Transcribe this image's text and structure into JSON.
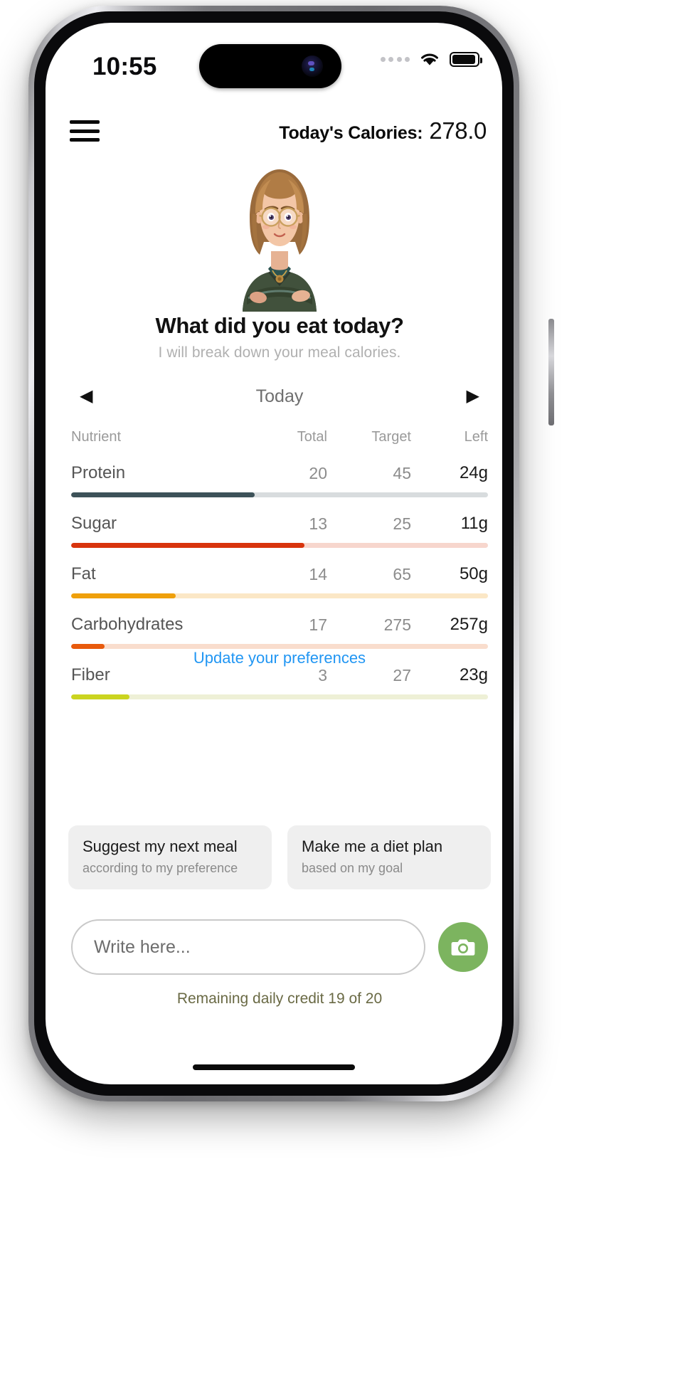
{
  "status_bar": {
    "time": "10:55",
    "signal_icon": "signal-dots-icon",
    "wifi_icon": "wifi-icon",
    "battery_icon": "battery-icon"
  },
  "header": {
    "menu_icon": "hamburger-menu-icon",
    "calories_label": "Today's Calories:",
    "calories_value": "278.0"
  },
  "hero": {
    "avatar_name": "nutritionist-avatar",
    "title": "What did you eat today?",
    "subtitle": "I will break down your meal calories."
  },
  "date_nav": {
    "prev_icon": "◀",
    "label": "Today",
    "next_icon": "▶"
  },
  "table": {
    "columns": [
      "Nutrient",
      "Total",
      "Target",
      "Left"
    ],
    "rows": [
      {
        "name": "Protein",
        "total": "20",
        "target": "45",
        "left": "24g",
        "percent": 44,
        "fill_color": "#3d5259",
        "track_color": "#d8dcde"
      },
      {
        "name": "Sugar",
        "total": "13",
        "target": "25",
        "left": "11g",
        "percent": 56,
        "fill_color": "#d8340d",
        "track_color": "#f7d6cd"
      },
      {
        "name": "Fat",
        "total": "14",
        "target": "65",
        "left": "50g",
        "percent": 25,
        "fill_color": "#efa00b",
        "track_color": "#fbe7c6"
      },
      {
        "name": "Carbohydrates",
        "total": "17",
        "target": "275",
        "left": "257g",
        "percent": 8,
        "fill_color": "#e85a0c",
        "track_color": "#f9ddcd"
      },
      {
        "name": "Fiber",
        "total": "3",
        "target": "27",
        "left": "23g",
        "percent": 14,
        "fill_color": "#cbd41f",
        "track_color": "#eef0d6"
      }
    ]
  },
  "preferences_link": "Update your preferences",
  "suggestions": [
    {
      "title": "Suggest my next meal",
      "subtitle": "according to my preference"
    },
    {
      "title": "Make me a diet plan",
      "subtitle": "based on my goal"
    }
  ],
  "composer": {
    "placeholder": "Write here...",
    "camera_icon": "camera-icon",
    "camera_color": "#7cb45f"
  },
  "credit_text": "Remaining daily credit 19 of 20",
  "colors": {
    "link_blue": "#2196f3",
    "card_bg": "#efefef",
    "credit_text": "#6a6a45"
  }
}
